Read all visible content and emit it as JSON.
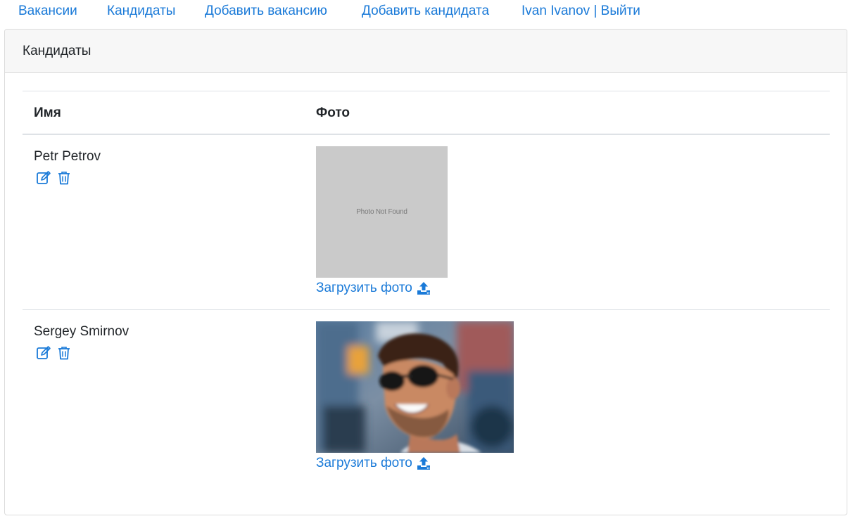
{
  "nav": {
    "vacancies": "Вакансии",
    "candidates": "Кандидаты",
    "add_vacancy": "Добавить вакансию",
    "add_candidate": "Добавить кандидата",
    "user_logout": "Ivan Ivanov | Выйти"
  },
  "card": {
    "title": "Кандидаты"
  },
  "table": {
    "headers": {
      "name": "Имя",
      "photo": "Фото"
    },
    "rows": [
      {
        "name": "Petr Petrov",
        "photo_placeholder": "Photo Not Found",
        "upload_label": "Загрузить фото"
      },
      {
        "name": "Sergey Smirnov",
        "upload_label": "Загрузить фото"
      }
    ]
  },
  "icons": {
    "edit": "edit-icon",
    "delete": "trash-icon",
    "upload": "upload-icon"
  },
  "colors": {
    "link": "#1a7ad8",
    "header_bg": "#f7f7f7",
    "placeholder_bg": "#cacaca"
  }
}
